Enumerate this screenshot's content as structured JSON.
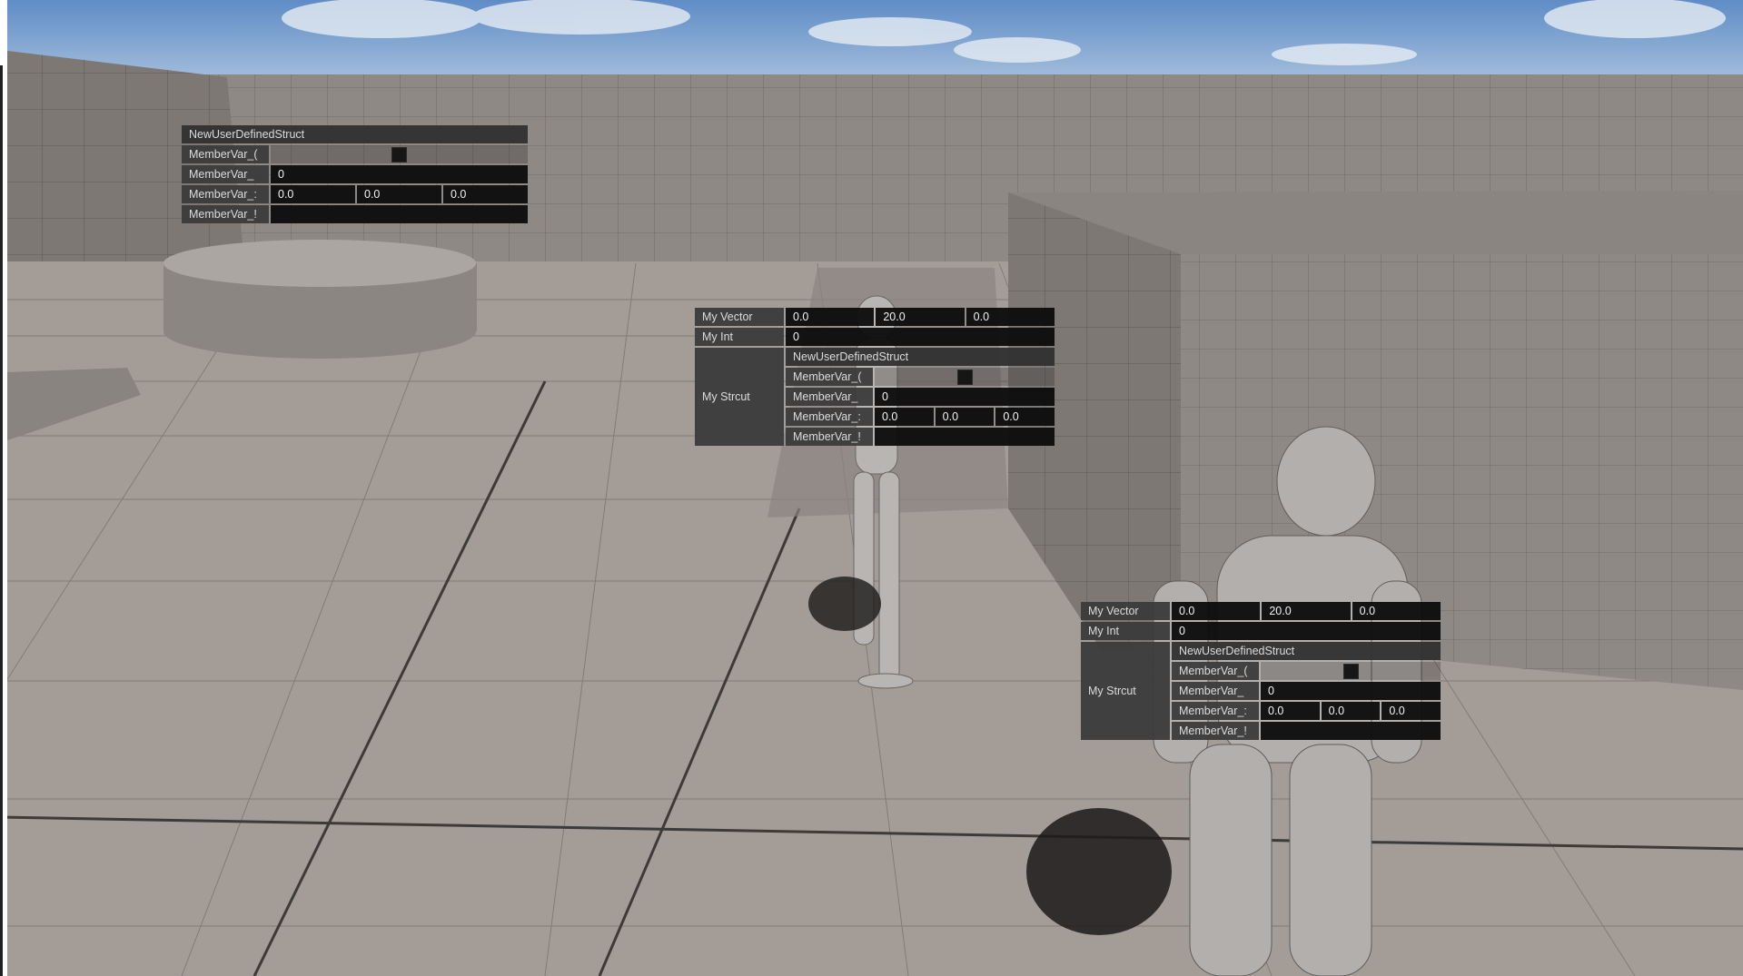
{
  "scene": {
    "sky_color": "#6e94c8",
    "floor_color": "#a39c97",
    "wall_color": "#8f8986",
    "grid_line_color": "#4a4542"
  },
  "top_left_struct": {
    "title": "NewUserDefinedStruct",
    "rows": [
      {
        "label": "MemberVar_(",
        "type": "checkbox"
      },
      {
        "label": "MemberVar_",
        "value": "0"
      },
      {
        "label": "MemberVar_:",
        "values": [
          "0.0",
          "0.0",
          "0.0"
        ]
      },
      {
        "label": "MemberVar_!",
        "value": ""
      }
    ]
  },
  "center_widget": {
    "my_vector_label": "My Vector",
    "my_vector": [
      "0.0",
      "20.0",
      "0.0"
    ],
    "my_int_label": "My Int",
    "my_int": "0",
    "my_struct_label": "My Strcut",
    "struct_title": "NewUserDefinedStruct",
    "rows": [
      {
        "label": "MemberVar_(",
        "type": "checkbox"
      },
      {
        "label": "MemberVar_",
        "value": "0"
      },
      {
        "label": "MemberVar_:",
        "values": [
          "0.0",
          "0.0",
          "0.0"
        ]
      },
      {
        "label": "MemberVar_!",
        "value": ""
      }
    ]
  },
  "right_widget": {
    "my_vector_label": "My Vector",
    "my_vector": [
      "0.0",
      "20.0",
      "0.0"
    ],
    "my_int_label": "My Int",
    "my_int": "0",
    "my_struct_label": "My Strcut",
    "struct_title": "NewUserDefinedStruct",
    "rows": [
      {
        "label": "MemberVar_(",
        "type": "checkbox"
      },
      {
        "label": "MemberVar_",
        "value": "0"
      },
      {
        "label": "MemberVar_:",
        "values": [
          "0.0",
          "0.0",
          "0.0"
        ]
      },
      {
        "label": "MemberVar_!",
        "value": ""
      }
    ]
  }
}
